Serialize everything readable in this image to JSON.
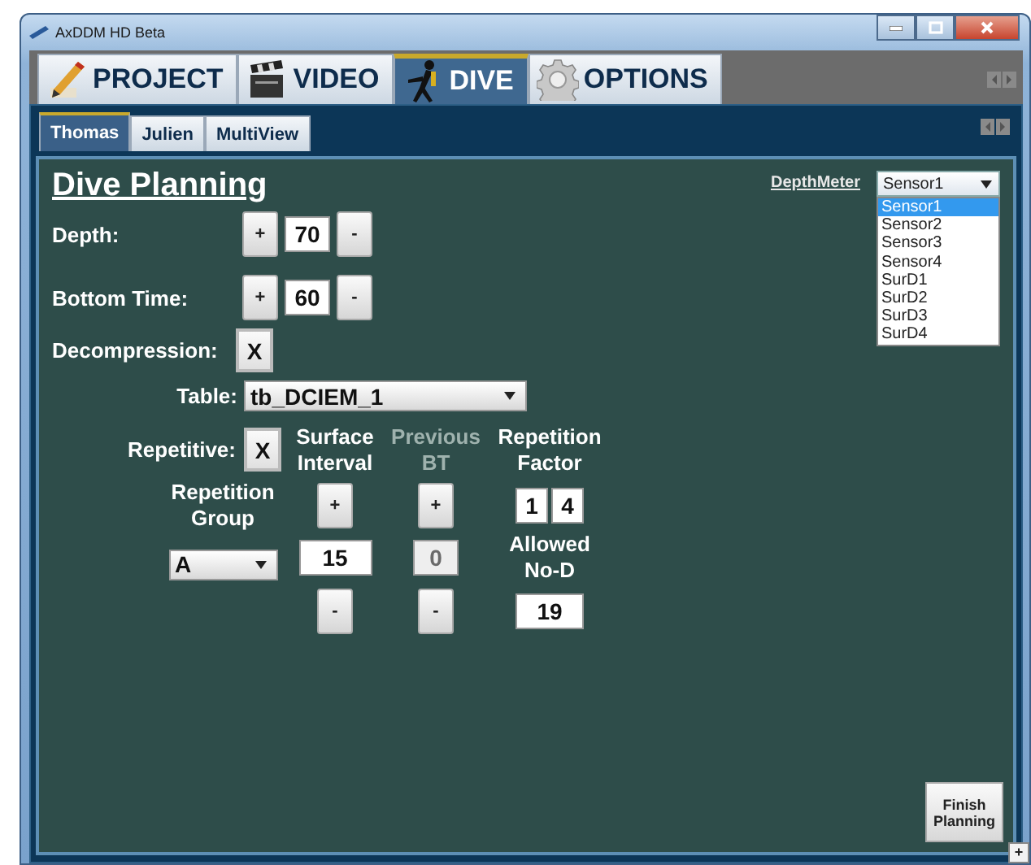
{
  "window": {
    "title": "AxDDM HD Beta"
  },
  "main_tabs": [
    {
      "label": "PROJECT",
      "selected": false
    },
    {
      "label": "VIDEO",
      "selected": false
    },
    {
      "label": "DIVE",
      "selected": true
    },
    {
      "label": "OPTIONS",
      "selected": false
    }
  ],
  "sub_tabs": [
    {
      "label": "Thomas",
      "selected": true
    },
    {
      "label": "Julien",
      "selected": false
    },
    {
      "label": "MultiView",
      "selected": false
    }
  ],
  "form": {
    "title": "Dive Planning",
    "depth": {
      "label": "Depth:",
      "plus": "+",
      "value": "70",
      "minus": "-"
    },
    "bottom_time": {
      "label": "Bottom Time:",
      "plus": "+",
      "value": "60",
      "minus": "-"
    },
    "decompression": {
      "label": "Decompression:",
      "checked": true,
      "mark": "X"
    },
    "table": {
      "label": "Table:",
      "value": "tb_DCIEM_1"
    },
    "repetitive": {
      "label": "Repetitive:",
      "checked": true,
      "mark": "X"
    },
    "surface_interval": {
      "label": "Surface Interval",
      "plus": "+",
      "value": "15",
      "minus": "-",
      "disabled": false
    },
    "previous_bt": {
      "label": "Previous BT",
      "plus": "+",
      "value": "0",
      "minus": "-",
      "disabled": true
    },
    "repetition_factor": {
      "label": "Repetition Factor",
      "digits": [
        "1",
        "4"
      ]
    },
    "repetition_group": {
      "label": "Repetition Group",
      "value": "A"
    },
    "allowed_no_d": {
      "label": "Allowed No-D",
      "value": "19"
    }
  },
  "depth_meter": {
    "label": "DepthMeter",
    "value": "Sensor1",
    "expanded": true,
    "options": [
      {
        "label": "Sensor1",
        "selected": true
      },
      {
        "label": "Sensor2",
        "selected": false
      },
      {
        "label": "Sensor3",
        "selected": false
      },
      {
        "label": "Sensor4",
        "selected": false
      },
      {
        "label": "SurD1",
        "selected": false
      },
      {
        "label": "SurD2",
        "selected": false
      },
      {
        "label": "SurD3",
        "selected": false
      },
      {
        "label": "SurD4",
        "selected": false
      }
    ]
  },
  "finish_button": "Finish Planning",
  "corner_button": "+"
}
